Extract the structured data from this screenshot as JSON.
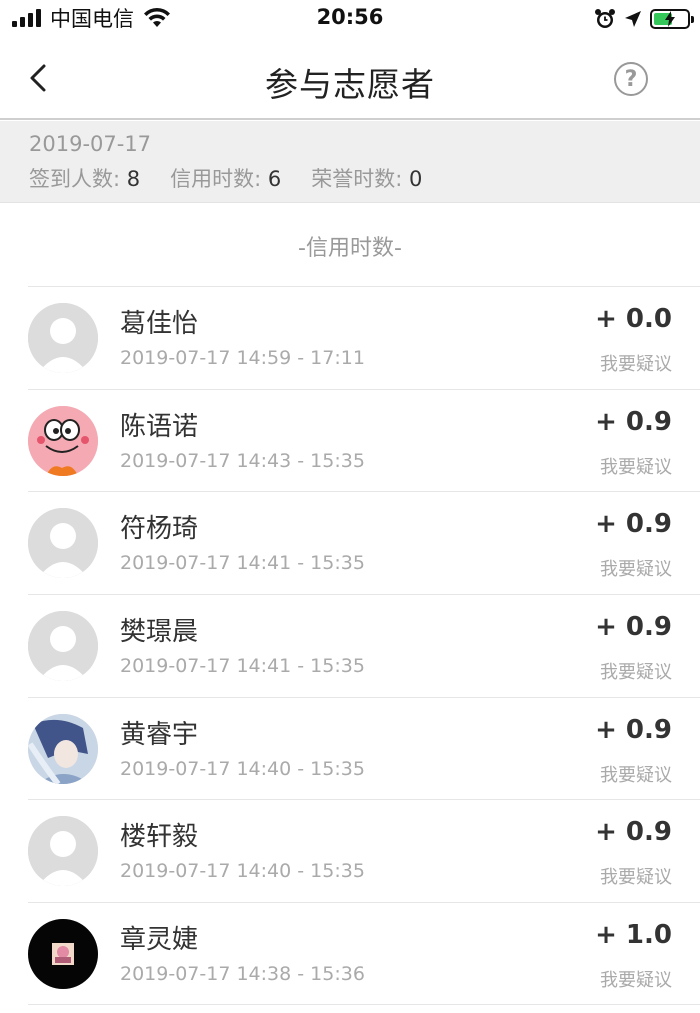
{
  "status_bar": {
    "carrier": "中国电信",
    "time": "20:56"
  },
  "nav": {
    "title": "参与志愿者",
    "help_icon": "question-circle-icon",
    "back_icon": "chevron-left-icon"
  },
  "summary": {
    "date": "2019-07-17",
    "checkin_label": "签到人数:",
    "checkin_value": "8",
    "credit_label": "信用时数:",
    "credit_value": "6",
    "honor_label": "荣誉时数:",
    "honor_value": "0"
  },
  "section_title": "-信用时数-",
  "volunteers": [
    {
      "name": "葛佳怡",
      "time": "2019-07-17 14:59 - 17:11",
      "points": "+ 0.0",
      "dispute": "我要疑议",
      "avatar": "default"
    },
    {
      "name": "陈语诺",
      "time": "2019-07-17 14:43 - 15:35",
      "points": "+ 0.9",
      "dispute": "我要疑议",
      "avatar": "patrick"
    },
    {
      "name": "符杨琦",
      "time": "2019-07-17 14:41 - 15:35",
      "points": "+ 0.9",
      "dispute": "我要疑议",
      "avatar": "default"
    },
    {
      "name": "樊璟晨",
      "time": "2019-07-17 14:41 - 15:35",
      "points": "+ 0.9",
      "dispute": "我要疑议",
      "avatar": "default"
    },
    {
      "name": "黄睿宇",
      "time": "2019-07-17 14:40 - 15:35",
      "points": "+ 0.9",
      "dispute": "我要疑议",
      "avatar": "anime"
    },
    {
      "name": "楼轩毅",
      "time": "2019-07-17 14:40 - 15:35",
      "points": "+ 0.9",
      "dispute": "我要疑议",
      "avatar": "default"
    },
    {
      "name": "章灵婕",
      "time": "2019-07-17 14:38 - 15:36",
      "points": "+ 1.0",
      "dispute": "我要疑议",
      "avatar": "dark"
    }
  ]
}
